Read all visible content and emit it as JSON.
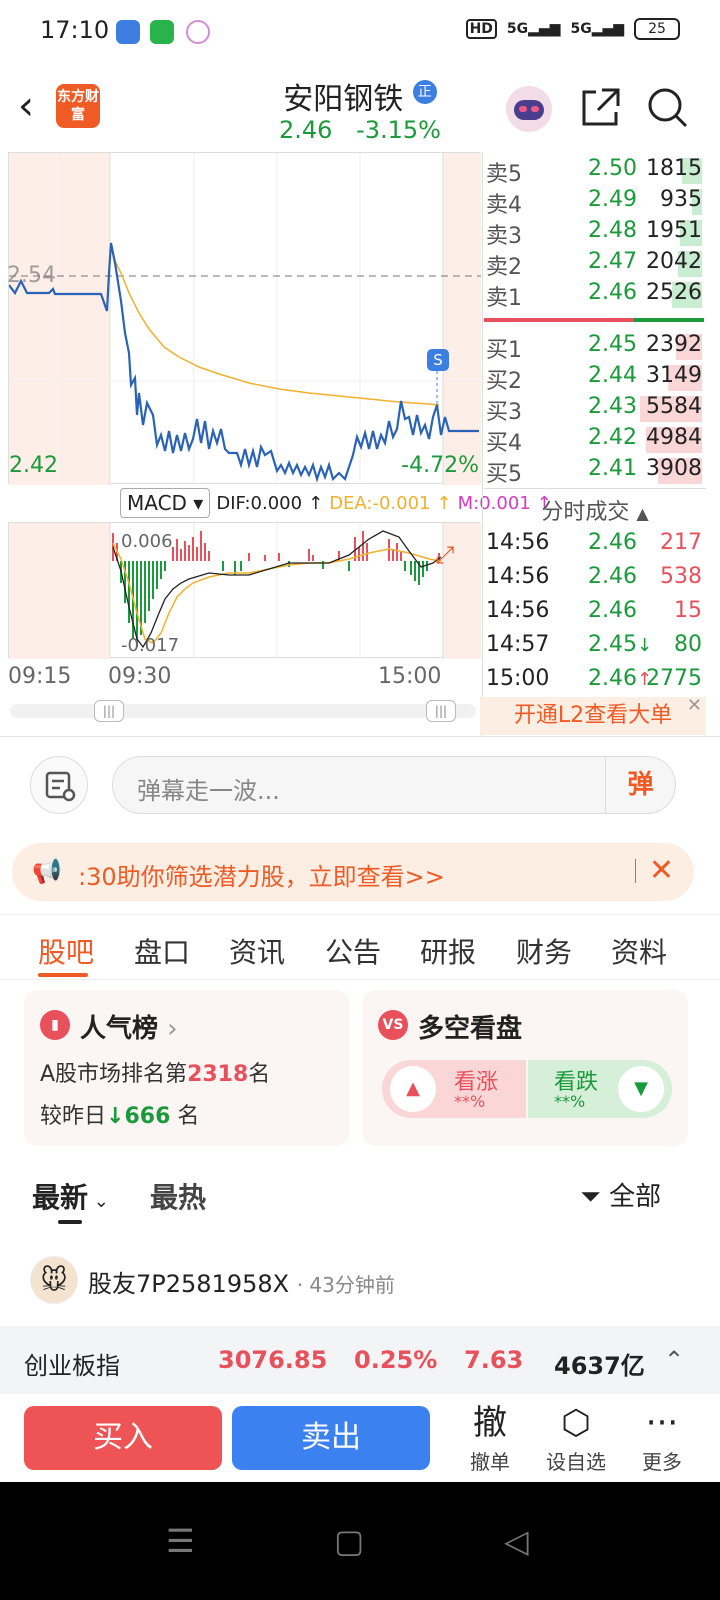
{
  "status": {
    "time": "17:10",
    "network": "HD",
    "signal1": "5G",
    "signal2": "5G",
    "battery": "25"
  },
  "header": {
    "logo_text": "东方财富",
    "title": "安阳钢铁",
    "badge": "正",
    "price": "2.46",
    "change_pct": "-3.15%"
  },
  "chart": {
    "ref_price": "2.54",
    "low_price": "2.42",
    "low_pct": "-4.72%",
    "s_marker": "S",
    "x_labels": [
      "09:15",
      "09:30",
      "15:00"
    ]
  },
  "macd": {
    "selector": "MACD",
    "dif": "DIF:0.000",
    "dea": "DEA:-0.001",
    "m": "M:0.001",
    "top": "0.006",
    "bottom": "-0.017"
  },
  "orderbook": {
    "asks": [
      {
        "label": "卖5",
        "price": "2.50",
        "vol": "1815"
      },
      {
        "label": "卖4",
        "price": "2.49",
        "vol": "935"
      },
      {
        "label": "卖3",
        "price": "2.48",
        "vol": "1951"
      },
      {
        "label": "卖2",
        "price": "2.47",
        "vol": "2042"
      },
      {
        "label": "卖1",
        "price": "2.46",
        "vol": "2526"
      }
    ],
    "bids": [
      {
        "label": "买1",
        "price": "2.45",
        "vol": "2392"
      },
      {
        "label": "买2",
        "price": "2.44",
        "vol": "3149"
      },
      {
        "label": "买3",
        "price": "2.43",
        "vol": "5584"
      },
      {
        "label": "买4",
        "price": "2.42",
        "vol": "4984"
      },
      {
        "label": "买5",
        "price": "2.41",
        "vol": "3908"
      }
    ]
  },
  "trades": {
    "title": "分时成交",
    "rows": [
      {
        "time": "14:56",
        "price": "2.46",
        "vol": "217",
        "arrow": ""
      },
      {
        "time": "14:56",
        "price": "2.46",
        "vol": "538",
        "arrow": ""
      },
      {
        "time": "14:56",
        "price": "2.46",
        "vol": "15",
        "arrow": ""
      },
      {
        "time": "14:57",
        "price": "2.45",
        "vol": "80",
        "arrow": "↓"
      },
      {
        "time": "15:00",
        "price": "2.46",
        "vol": "2775",
        "arrow": "↑"
      }
    ],
    "l2": "开通L2查看大单"
  },
  "comment": {
    "placeholder": "弹幕走一波...",
    "dan": "弹"
  },
  "banner": {
    "text": ":30助你筛选潜力股，立即查看>>"
  },
  "tabs": [
    "股吧",
    "盘口",
    "资讯",
    "公告",
    "研报",
    "财务",
    "资料"
  ],
  "popularity": {
    "title": "人气榜",
    "rank_prefix": "A股市场排名第",
    "rank": "2318",
    "rank_suffix": "名",
    "cmp_prefix": "较昨日",
    "cmp_value": "666",
    "cmp_suffix": "名"
  },
  "vote": {
    "title": "多空看盘",
    "up": "看涨",
    "up_pct": "**%",
    "down": "看跌",
    "down_pct": "**%"
  },
  "feed": {
    "tab_latest": "最新",
    "tab_hot": "最热",
    "filter": "全部",
    "user": "股友7P2581958X",
    "ago": "· 43分钟前"
  },
  "index": {
    "name": "创业板指",
    "value": "3076.85",
    "pct": "0.25%",
    "change": "7.63",
    "amount": "4637亿"
  },
  "actions": {
    "buy": "买入",
    "sell": "卖出",
    "cancel_glyph": "撤",
    "cancel": "撤单",
    "watch": "设自选",
    "more": "更多"
  },
  "colors": {
    "accent": "#f05a24",
    "up": "#e8505b",
    "down": "#1a9a3a",
    "price_line": "#2a62b8",
    "avg_line": "#f0b12c"
  }
}
